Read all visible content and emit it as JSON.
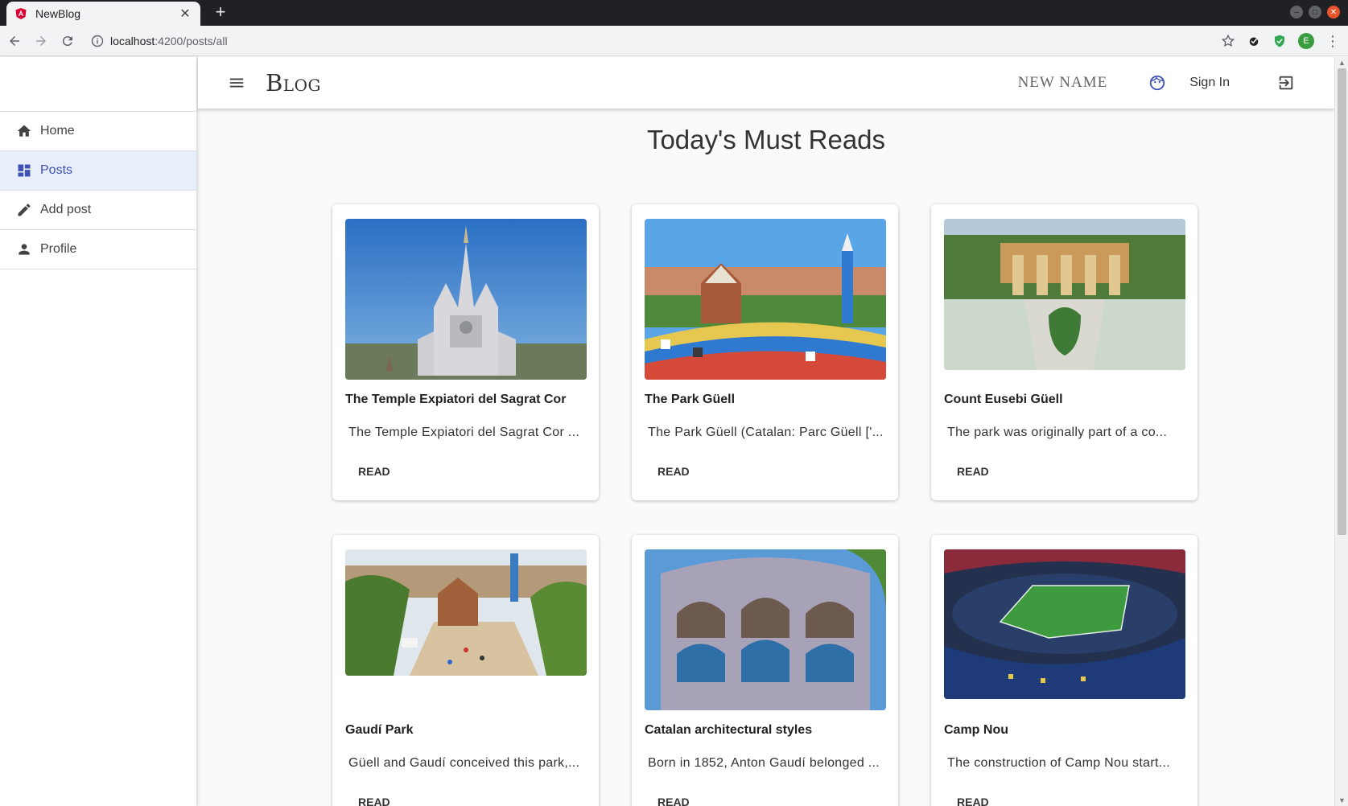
{
  "browser": {
    "tab_title": "NewBlog",
    "url_host": "localhost",
    "url_path": ":4200/posts/all",
    "profile_initial": "E"
  },
  "app": {
    "brand": "Blog",
    "user_name": "NEW NAME",
    "sign_in": "Sign In"
  },
  "sidebar": {
    "items": [
      {
        "label": "Home",
        "icon": "home-icon"
      },
      {
        "label": "Posts",
        "icon": "dashboard-icon",
        "active": true
      },
      {
        "label": "Add post",
        "icon": "edit-icon"
      },
      {
        "label": "Profile",
        "icon": "person-icon"
      }
    ]
  },
  "main": {
    "heading": "Today's Must Reads",
    "posts": [
      {
        "title": "The Temple Expiatori del Sagrat Cor",
        "excerpt": "The Temple Expiatori del Sagrat Cor ...",
        "action": "READ"
      },
      {
        "title": "The Park Güell",
        "excerpt": "The Park Güell (Catalan: Parc Güell ['...",
        "action": "READ"
      },
      {
        "title": "Count Eusebi Güell",
        "excerpt": "The park was originally part of a co...",
        "action": "READ"
      },
      {
        "title": "Gaudí Park",
        "excerpt": "Güell and Gaudí conceived this park,...",
        "action": "READ"
      },
      {
        "title": "Catalan architectural styles",
        "excerpt": "Born in 1852, Anton Gaudí belonged ...",
        "action": "READ"
      },
      {
        "title": "Camp Nou",
        "excerpt": "The construction of Camp Nou start...",
        "action": "READ"
      }
    ]
  },
  "colors": {
    "accent": "#3f51b5",
    "active_bg": "#e8eefa"
  }
}
